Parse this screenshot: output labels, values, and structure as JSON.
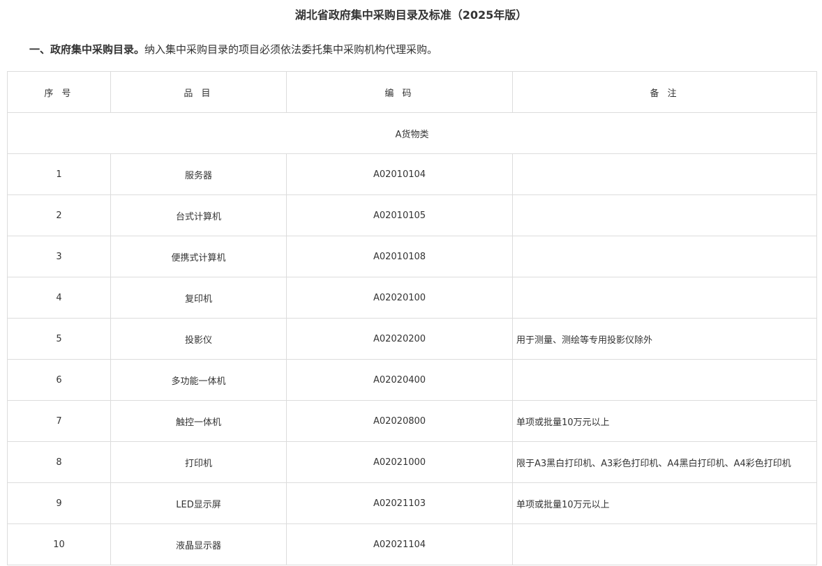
{
  "document": {
    "title": "湖北省政府集中采购目录及标准（2025年版）",
    "intro_lead": "一、政府集中采购目录。",
    "intro_text": "纳入集中采购目录的项目必须依法委托集中采购机构代理采购。"
  },
  "table": {
    "headers": [
      "序 号",
      "品 目",
      "编 码",
      "备 注"
    ],
    "section_label": "A货物类",
    "rows": [
      {
        "no": "1",
        "item": "服务器",
        "code": "A02010104",
        "remark": ""
      },
      {
        "no": "2",
        "item": "台式计算机",
        "code": "A02010105",
        "remark": ""
      },
      {
        "no": "3",
        "item": "便携式计算机",
        "code": "A02010108",
        "remark": ""
      },
      {
        "no": "4",
        "item": "复印机",
        "code": "A02020100",
        "remark": ""
      },
      {
        "no": "5",
        "item": "投影仪",
        "code": "A02020200",
        "remark": "用于测量、测绘等专用投影仪除外"
      },
      {
        "no": "6",
        "item": "多功能一体机",
        "code": "A02020400",
        "remark": ""
      },
      {
        "no": "7",
        "item": "触控一体机",
        "code": "A02020800",
        "remark": "单项或批量10万元以上"
      },
      {
        "no": "8",
        "item": "打印机",
        "code": "A02021000",
        "remark": "限于A3黑白打印机、A3彩色打印机、A4黑白打印机、A4彩色打印机"
      },
      {
        "no": "9",
        "item": "LED显示屏",
        "code": "A02021103",
        "remark": "单项或批量10万元以上"
      },
      {
        "no": "10",
        "item": "液晶显示器",
        "code": "A02021104",
        "remark": ""
      }
    ]
  },
  "colors": {
    "text": "#333333",
    "border": "#dcdcdc",
    "background": "#ffffff"
  }
}
